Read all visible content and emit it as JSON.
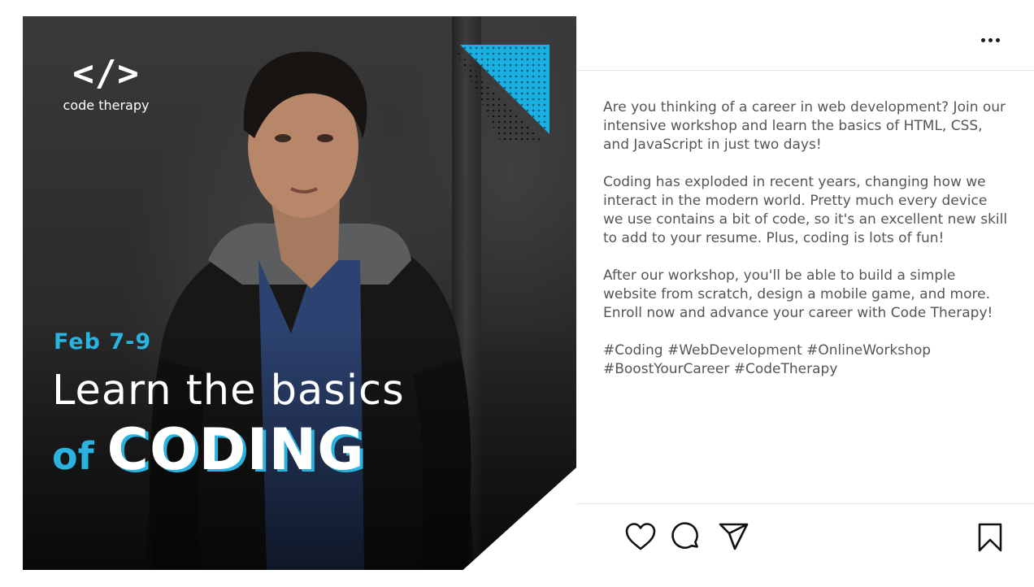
{
  "post": {
    "image": {
      "logo_glyph": "</>",
      "logo_name": "code therapy",
      "event_date": "Feb 7-9",
      "headline_line1": "Learn the basics",
      "headline_of": "of",
      "headline_coding": "CODING",
      "accent_color": "#2bb3e0"
    },
    "caption": {
      "paragraphs": [
        "Are you thinking of a career in web development? Join our intensive workshop and learn the basics of HTML, CSS, and JavaScript in just two days!",
        "Coding has exploded in recent years, changing how we interact in the modern world. Pretty much every device we use contains a bit of code, so it's an excellent new skill to add to your resume. Plus, coding is lots of fun!",
        "After our workshop, you'll be able to build a simple website from scratch, design a mobile game, and more. Enroll now and advance your career with Code Therapy!"
      ],
      "hashtags": "#Coding #WebDevelopment #OnlineWorkshop #BoostYourCareer #CodeTherapy"
    },
    "header": {
      "more_icon": "more-horizontal-icon"
    },
    "actions": {
      "like_icon": "heart-icon",
      "comment_icon": "comment-icon",
      "share_icon": "paper-plane-icon",
      "save_icon": "bookmark-icon"
    }
  }
}
